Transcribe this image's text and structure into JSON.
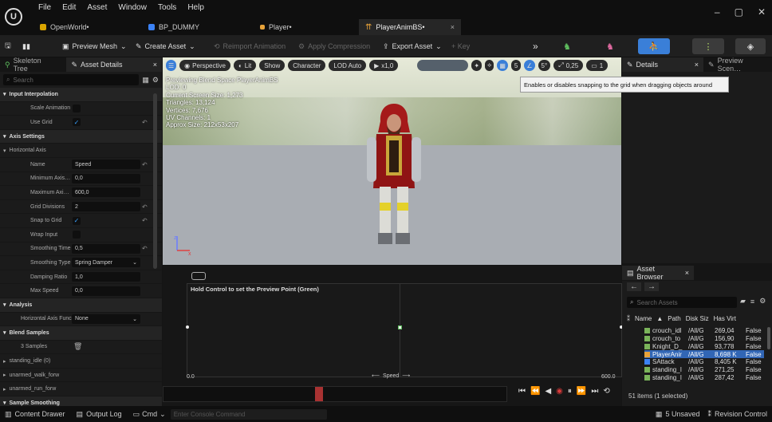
{
  "app": {
    "logo": "U",
    "menu": [
      "File",
      "Edit",
      "Asset",
      "Window",
      "Tools",
      "Help"
    ],
    "tabs": [
      {
        "label": "OpenWorld•",
        "color": "#d9a400"
      },
      {
        "label": "BP_DUMMY",
        "color": "#3b82f6"
      },
      {
        "label": "Player•",
        "color": "#e8a33a"
      },
      {
        "label": "PlayerAnimBS•",
        "color": "#e8a33a",
        "active": true
      }
    ]
  },
  "toolbar": {
    "preview_mesh": "Preview Mesh",
    "create_asset": "Create Asset",
    "reimport": "Reimport Animation",
    "apply_compression": "Apply Compression",
    "export_asset": "Export Asset",
    "key": "+ Key"
  },
  "left": {
    "tab_skeleton": "Skeleton Tree",
    "tab_details": "Asset Details",
    "search_placeholder": "Search",
    "rows": [
      {
        "type": "cat",
        "label": "Input Interpolation"
      },
      {
        "type": "check",
        "label": "Scale Animation",
        "checked": false
      },
      {
        "type": "check",
        "label": "Use Grid",
        "checked": true,
        "reset": true
      },
      {
        "type": "cat",
        "label": "Axis Settings"
      },
      {
        "type": "sub",
        "label": "Horizontal Axis"
      },
      {
        "type": "field",
        "label": "Name",
        "value": "Speed",
        "reset": true
      },
      {
        "type": "field",
        "label": "Minimum Axis…",
        "value": "0,0"
      },
      {
        "type": "field",
        "label": "Maximum Axi…",
        "value": "600,0"
      },
      {
        "type": "field",
        "label": "Grid Divisions",
        "value": "2",
        "reset": true
      },
      {
        "type": "check",
        "label": "Snap to Grid",
        "checked": true,
        "reset": true
      },
      {
        "type": "check",
        "label": "Wrap Input",
        "checked": false
      },
      {
        "type": "field",
        "label": "Smoothing Time",
        "value": "0,5",
        "reset": true
      },
      {
        "type": "field",
        "label": "Smoothing Type",
        "value": "Spring Damper",
        "dropdown": true
      },
      {
        "type": "field",
        "label": "Damping Ratio",
        "value": "1,0"
      },
      {
        "type": "field",
        "label": "Max Speed",
        "value": "0,0"
      },
      {
        "type": "cat",
        "label": "Analysis"
      },
      {
        "type": "field2",
        "label": "Horizontal Axis Func",
        "value": "None",
        "dropdown": true
      },
      {
        "type": "cat",
        "label": "Blend Samples"
      },
      {
        "type": "samples",
        "label": "3 Samples"
      },
      {
        "type": "item",
        "label": "standing_idle (0)"
      },
      {
        "type": "item",
        "label": "unarmed_walk_forw"
      },
      {
        "type": "item",
        "label": "unarmed_run_forw"
      },
      {
        "type": "cat",
        "label": "Sample Smoothing"
      }
    ]
  },
  "viewport": {
    "perspective": "Perspective",
    "lit": "Lit",
    "show": "Show",
    "character": "Character",
    "lod": "LOD Auto",
    "speed": "x1,0",
    "grid_val": "5",
    "rot_val": "5°",
    "scale_val": "0,25",
    "cam_val": "1",
    "stats": [
      "Previewing Blend Space PlayerAnimBS",
      "LOD: 0",
      "Current Screen Size: 1,273",
      "Triangles: 13,124",
      "Vertices: 7,676",
      "UV Channels: 1",
      "Approx Size: 212x53x207"
    ],
    "tooltip": "Enables or disables snapping to the grid when dragging objects around"
  },
  "blend": {
    "hint": "Hold Control to set the Preview Point (Green)",
    "x_min": "0.0",
    "x_max": "600.0",
    "axis": "Speed"
  },
  "details": {
    "tab": "Details",
    "tab2": "Preview Scen…"
  },
  "asset_browser": {
    "tab": "Asset Browser",
    "search_placeholder": "Search Assets",
    "col_name": "Name",
    "col_path": "Path",
    "col_size": "Disk Siz",
    "col_virt": "Has Virt",
    "rows": [
      {
        "name": "crouch_idl",
        "path": "/All/G",
        "size": "269,04",
        "virt": "False",
        "color": "#7ab35a"
      },
      {
        "name": "crouch_to",
        "path": "/All/G",
        "size": "156,90",
        "virt": "False",
        "color": "#7ab35a"
      },
      {
        "name": "Knight_D_",
        "path": "/All/G",
        "size": "93,778",
        "virt": "False",
        "color": "#7ab35a"
      },
      {
        "name": "PlayerAnir",
        "path": "/All/G",
        "size": "8,698 K",
        "virt": "False",
        "color": "#e8a33a",
        "selected": true
      },
      {
        "name": "SAttack",
        "path": "/All/G",
        "size": "8,405 K",
        "virt": "False",
        "color": "#3b82f6"
      },
      {
        "name": "standing_I",
        "path": "/All/G",
        "size": "271,25",
        "virt": "False",
        "color": "#7ab35a"
      },
      {
        "name": "standing_I",
        "path": "/All/G",
        "size": "287,42",
        "virt": "False",
        "color": "#7ab35a"
      }
    ],
    "count": "51 items (1 selected)"
  },
  "status": {
    "content_drawer": "Content Drawer",
    "output_log": "Output Log",
    "cmd": "Cmd",
    "console_placeholder": "Enter Console Command",
    "unsaved": "5 Unsaved",
    "revision": "Revision Control"
  }
}
